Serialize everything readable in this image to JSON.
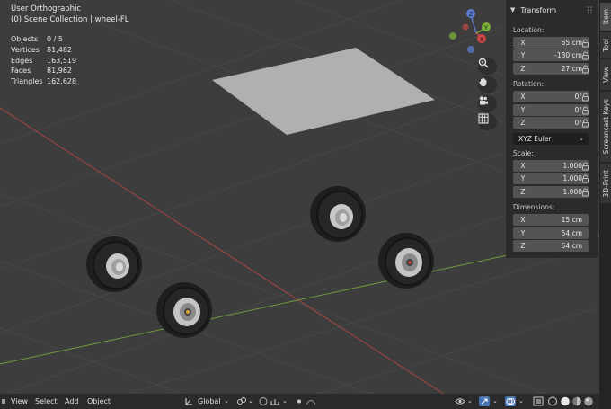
{
  "viewport": {
    "title": "User Orthographic",
    "subtitle": "(0) Scene Collection | wheel-FL",
    "stats": [
      {
        "label": "Objects",
        "value": "0 / 5"
      },
      {
        "label": "Vertices",
        "value": "81,482"
      },
      {
        "label": "Edges",
        "value": "163,519"
      },
      {
        "label": "Faces",
        "value": "81,962"
      },
      {
        "label": "Triangles",
        "value": "162,628"
      }
    ],
    "gizmo_axes": {
      "z": "Z",
      "y": "Y",
      "x": "X"
    },
    "colors": {
      "background": "#3d3d3d",
      "x_axis": "#b94a4a",
      "y_axis": "#6f9a3a",
      "plane": "#b0b0b0"
    }
  },
  "nav_buttons": [
    "zoom-icon",
    "hand-icon",
    "camera-icon",
    "grid-icon"
  ],
  "npanel": {
    "title": "Transform",
    "location_label": "Location:",
    "location": [
      {
        "axis": "X",
        "value": "65 cm"
      },
      {
        "axis": "Y",
        "value": "-130 cm"
      },
      {
        "axis": "Z",
        "value": "27 cm"
      }
    ],
    "rotation_label": "Rotation:",
    "rotation": [
      {
        "axis": "X",
        "value": "0°"
      },
      {
        "axis": "Y",
        "value": "0°"
      },
      {
        "axis": "Z",
        "value": "0°"
      }
    ],
    "rotation_mode": "XYZ Euler",
    "scale_label": "Scale:",
    "scale": [
      {
        "axis": "X",
        "value": "1.000"
      },
      {
        "axis": "Y",
        "value": "1.000"
      },
      {
        "axis": "Z",
        "value": "1.000"
      }
    ],
    "dimensions_label": "Dimensions:",
    "dimensions": [
      {
        "axis": "X",
        "value": "15 cm"
      },
      {
        "axis": "Y",
        "value": "54 cm"
      },
      {
        "axis": "Z",
        "value": "54 cm"
      }
    ]
  },
  "tabs": [
    "Item",
    "Tool",
    "View",
    "Screencast Keys",
    "3D-Print"
  ],
  "bottombar": {
    "menus": [
      "View",
      "Select",
      "Add",
      "Object"
    ],
    "orientation": "Global"
  }
}
